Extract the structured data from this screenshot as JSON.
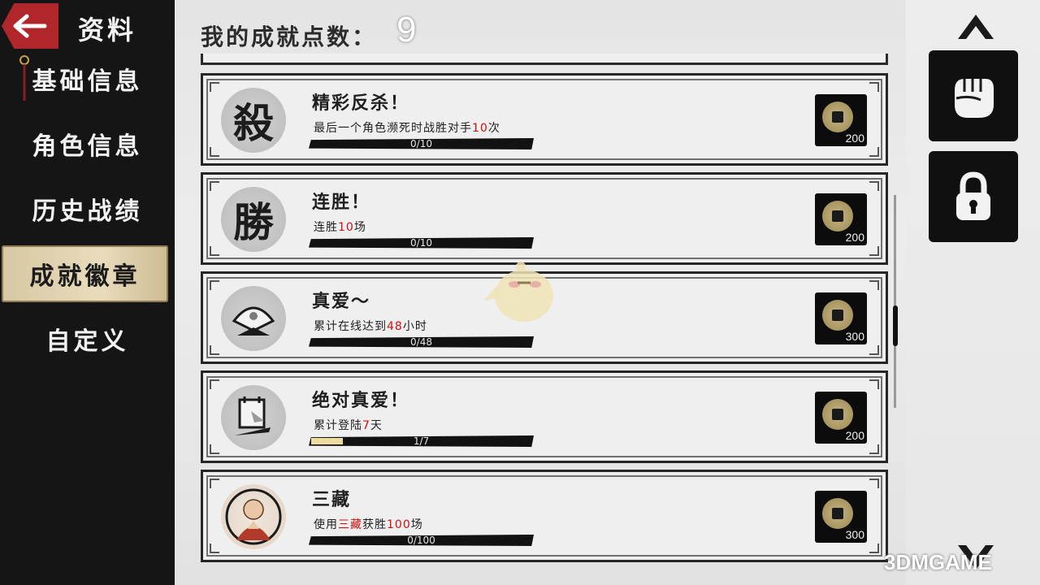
{
  "sidebar": {
    "title": "资料",
    "items": [
      {
        "label": "基础信息",
        "active": false
      },
      {
        "label": "角色信息",
        "active": false
      },
      {
        "label": "历史战绩",
        "active": false
      },
      {
        "label": "成就徽章",
        "active": true
      },
      {
        "label": "自定义",
        "active": false
      }
    ]
  },
  "header": {
    "points_label": "我的成就点数：",
    "points_value": "9"
  },
  "achievements": [
    {
      "badge_glyph": "殺",
      "badge_icon": "kill-glyph-icon",
      "title": "精彩反杀！",
      "desc_before": "最后一个角色濒死时战胜对手",
      "desc_highlight": "10",
      "desc_after": "次",
      "progress_text": "0/10",
      "progress_fraction": 0,
      "reward": "200"
    },
    {
      "badge_glyph": "勝",
      "badge_icon": "win-glyph-icon",
      "title": "连胜！",
      "desc_before": "连胜",
      "desc_highlight": "10",
      "desc_after": "场",
      "progress_text": "0/10",
      "progress_fraction": 0,
      "reward": "200"
    },
    {
      "badge_glyph": "",
      "badge_icon": "fan-icon",
      "title": "真爱～",
      "desc_before": "累计在线达到",
      "desc_highlight": "48",
      "desc_after": "小时",
      "progress_text": "0/48",
      "progress_fraction": 0,
      "reward": "300"
    },
    {
      "badge_glyph": "",
      "badge_icon": "calendar-icon",
      "title": "绝对真爱！",
      "desc_before": "累计登陆",
      "desc_highlight": "7",
      "desc_after": "天",
      "progress_text": "1/7",
      "progress_fraction": 0.143,
      "reward": "200"
    },
    {
      "badge_glyph": "",
      "badge_icon": "monk-portrait-icon",
      "title": "三藏",
      "desc_before": "使用",
      "desc_highlight": "三藏",
      "desc_after": "获胜",
      "desc_highlight2": "100",
      "desc_after2": "场",
      "progress_text": "0/100",
      "progress_fraction": 0,
      "reward": "300"
    }
  ],
  "right_panel": {
    "tabs": [
      {
        "icon": "fist-icon",
        "selected": true
      },
      {
        "icon": "lock-icon",
        "selected": false
      }
    ]
  },
  "watermark": "3DMGAME",
  "colors": {
    "sidebar_bg": "#151515",
    "back_button": "#b0262a",
    "active_tab": "#e9dcbc",
    "highlight_text": "#d10f0f",
    "progress_fill": "#ecdca1"
  }
}
